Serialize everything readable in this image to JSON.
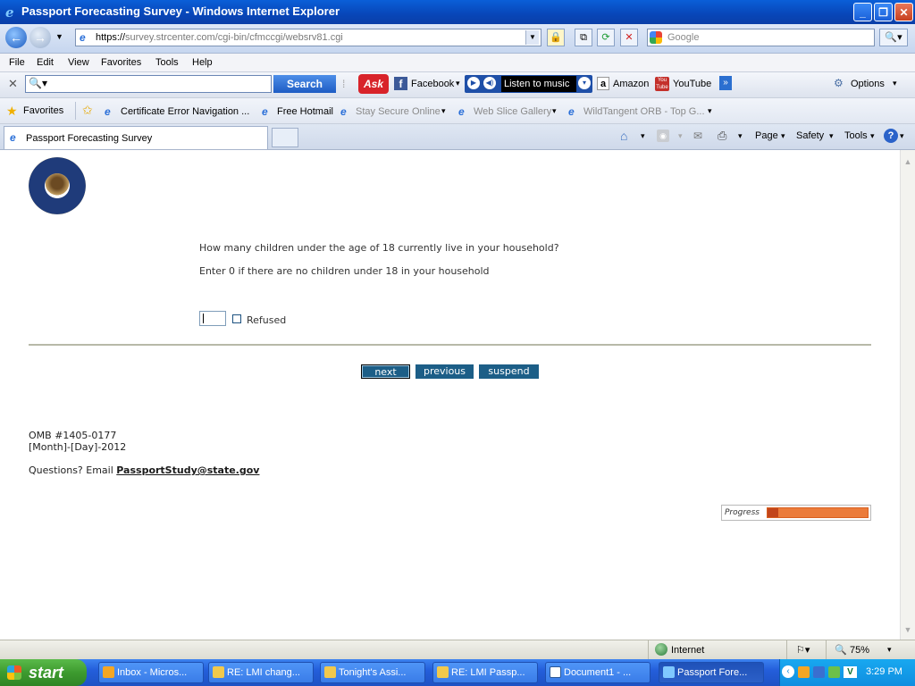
{
  "window": {
    "title": "Passport Forecasting Survey - Windows Internet Explorer",
    "min": "_",
    "max": "❐",
    "close": "✕"
  },
  "address": {
    "scheme": "https://",
    "host": "survey.strcenter.com",
    "path": "/cgi-bin/cfmccgi/websrv81.cgi",
    "search_placeholder": "Google"
  },
  "menu": [
    "File",
    "Edit",
    "View",
    "Favorites",
    "Tools",
    "Help"
  ],
  "toolbar": {
    "search_button": "Search",
    "facebook": "Facebook",
    "listen": "Listen to music",
    "amazon": "Amazon",
    "youtube": "YouTube",
    "options": "Options"
  },
  "favorites": {
    "label": "Favorites",
    "items": [
      "Certificate Error Navigation ...",
      "Free Hotmail",
      "Stay Secure Online",
      "Web Slice Gallery",
      "WildTangent ORB - Top G..."
    ]
  },
  "tab": {
    "title": "Passport Forecasting Survey"
  },
  "commandbar": {
    "page": "Page",
    "safety": "Safety",
    "tools": "Tools"
  },
  "survey": {
    "question": "How many children under the age of 18 currently live in your household?",
    "instruction": "Enter 0 if there are no children under 18 in your household",
    "answer_value": "",
    "refused_label": "Refused",
    "buttons": {
      "next": "next",
      "previous": "previous",
      "suspend": "suspend"
    },
    "omb": "OMB #1405-0177",
    "date": "[Month]-[Day]-2012",
    "questions_prefix": "Questions? Email ",
    "email": "PassportStudy@state.gov",
    "progress_label": "Progress",
    "progress_fraction": 0.11
  },
  "statusbar": {
    "zone": "Internet",
    "zoom": "75%"
  },
  "taskbar": {
    "start": "start",
    "tasks": [
      "Inbox - Micros...",
      "RE: LMI chang...",
      "Tonight's Assi...",
      "RE: LMI Passp...",
      "Document1 - ...",
      "Passport Fore..."
    ],
    "clock": "3:29 PM"
  },
  "colors": {
    "button": "#1c5e87",
    "progress": "#eb7b3a",
    "title_bar": "#0846b8"
  }
}
